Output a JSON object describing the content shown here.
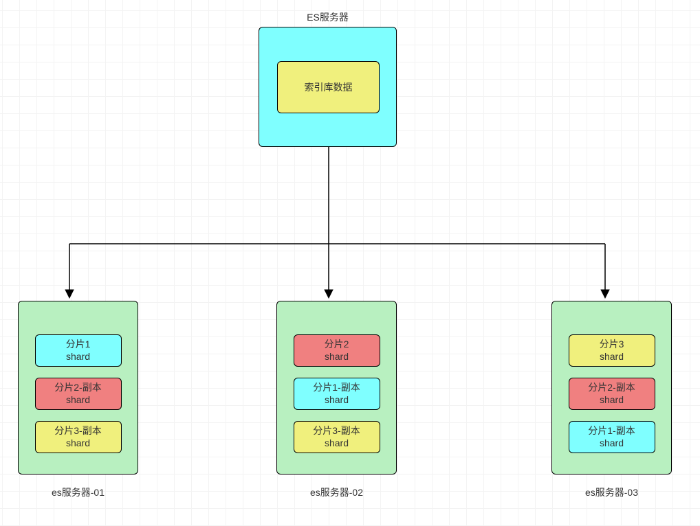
{
  "top": {
    "title": "ES服务器",
    "index_label": "索引库数据"
  },
  "servers": [
    {
      "caption": "es服务器-01",
      "shards": [
        {
          "line1": "分片1",
          "line2": "shard",
          "color": "cyan"
        },
        {
          "line1": "分片2-副本",
          "line2": "shard",
          "color": "red"
        },
        {
          "line1": "分片3-副本",
          "line2": "shard",
          "color": "yellow"
        }
      ]
    },
    {
      "caption": "es服务器-02",
      "shards": [
        {
          "line1": "分片2",
          "line2": "shard",
          "color": "red"
        },
        {
          "line1": "分片1-副本",
          "line2": "shard",
          "color": "cyan"
        },
        {
          "line1": "分片3-副本",
          "line2": "shard",
          "color": "yellow"
        }
      ]
    },
    {
      "caption": "es服务器-03",
      "shards": [
        {
          "line1": "分片3",
          "line2": "shard",
          "color": "yellow"
        },
        {
          "line1": "分片2-副本",
          "line2": "shard",
          "color": "red"
        },
        {
          "line1": "分片1-副本",
          "line2": "shard",
          "color": "cyan"
        }
      ]
    }
  ]
}
